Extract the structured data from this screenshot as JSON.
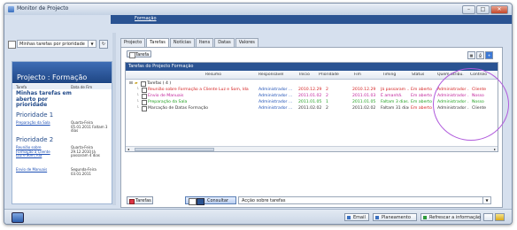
{
  "window": {
    "title": "Monitor de Projecto"
  },
  "menu": {
    "item": "Formação"
  },
  "sidebar": {
    "selector": "Minhas tarefas por prioridade",
    "project_title": "Projecto : Formação",
    "col_task": "Tarefa",
    "col_date": "Data de Fim",
    "big_task": "Minhas tarefas em aberto por prioridade",
    "prio1": "Prioridade 1",
    "prio2": "Prioridade 2",
    "items": [
      {
        "task": "Preparação da Sala",
        "meta": "Quarta-Feira 05.01.2011 Faltam 3 dias"
      },
      {
        "task": "Reunião sobre Formação a Cliente Luz e Som, lda",
        "meta": "Quarta-Feira 29.12.2010 Já passaram 4 dias"
      },
      {
        "task": "Envio de Manuais",
        "meta": "Segunda-Feira 03.01.2011"
      }
    ]
  },
  "tabs": [
    "Projecto",
    "Tarefas",
    "Notícias",
    "Itens",
    "Datas",
    "Valores"
  ],
  "toolbar": {
    "tarefa": "Tarefa"
  },
  "grid": {
    "title": "Tarefas do Projecto Formação",
    "headers": [
      "Resumo",
      "Responsável",
      "Início",
      "Prioridade",
      "Fim",
      "Timing",
      "Status",
      "Quem atribu..",
      "Controlo"
    ],
    "group": "Tarefas ( 4 )",
    "rows": [
      {
        "resumo": "Reunião sobre Formação a Cliente Luz e Som, lda",
        "resp": "Administrador ...",
        "inicio": "2010.12.29",
        "prio": "2",
        "fim": "2010.12.29",
        "timing": "Já passaram ...",
        "status": "Em aberto",
        "quem": "Administrador ...",
        "controlo": "Cliente"
      },
      {
        "resumo": "Envio de Manuais",
        "resp": "Administrador ...",
        "inicio": "2011.01.02",
        "prio": "2",
        "fim": "2011.01.03",
        "timing": "É amanhã.",
        "status": "Em aberto",
        "quem": "Administrador ...",
        "controlo": "Nosso"
      },
      {
        "resumo": "Preparação da Sala",
        "resp": "Administrador ...",
        "inicio": "2011.01.05",
        "prio": "1",
        "fim": "2011.01.05",
        "timing": "Faltam 3 dias.",
        "status": "Em aberto",
        "quem": "Administrador ...",
        "controlo": "Nosso"
      },
      {
        "resumo": "Marcação de Datas Formação",
        "resp": "Administrador ...",
        "inicio": "2011.02.02",
        "prio": "2",
        "fim": "2011.02.02",
        "timing": "Faltam 31 dias.",
        "status": "Em aberto",
        "quem": "Administrador ...",
        "controlo": "Cliente"
      }
    ]
  },
  "bottom": {
    "tarefas": "Tarefas",
    "consultar": "Consultar",
    "acao": "Acção sobre tarefas"
  },
  "statusbar": {
    "email": "Email",
    "planeamento": "Planeamento",
    "refresh": "Refrescar a informação"
  },
  "colors": {
    "overdue": "#d42020",
    "tomorrow": "#c0209a",
    "upcoming": "#20a020",
    "normal": "#333333",
    "header": "#2a5392"
  }
}
